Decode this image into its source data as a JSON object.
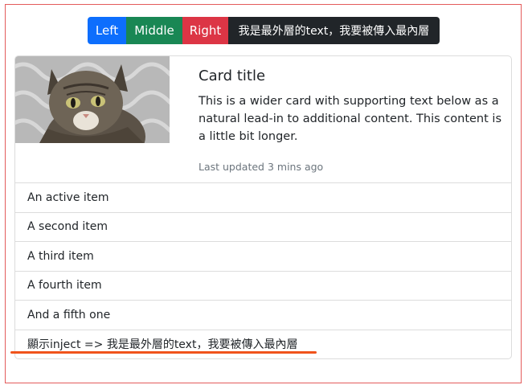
{
  "buttons": {
    "left": "Left",
    "middle": "Middle",
    "right": "Right",
    "dark": "我是最外層的text，我要被傳入最內層"
  },
  "card": {
    "title": "Card title",
    "text": "This is a wider card with supporting text below as a natural lead-in to additional content. This content is a little bit longer.",
    "updated": "Last updated 3 mins ago"
  },
  "list": {
    "items": [
      "An active item",
      "A second item",
      "A third item",
      "A fourth item",
      "And a fifth one",
      "顯示inject => 我是最外層的text，我要被傳入最內層"
    ]
  },
  "colors": {
    "primary": "#0d6efd",
    "success": "#198754",
    "danger": "#dc3545",
    "dark": "#212529",
    "frame": "#e35b5b",
    "underline": "#f0531b"
  }
}
